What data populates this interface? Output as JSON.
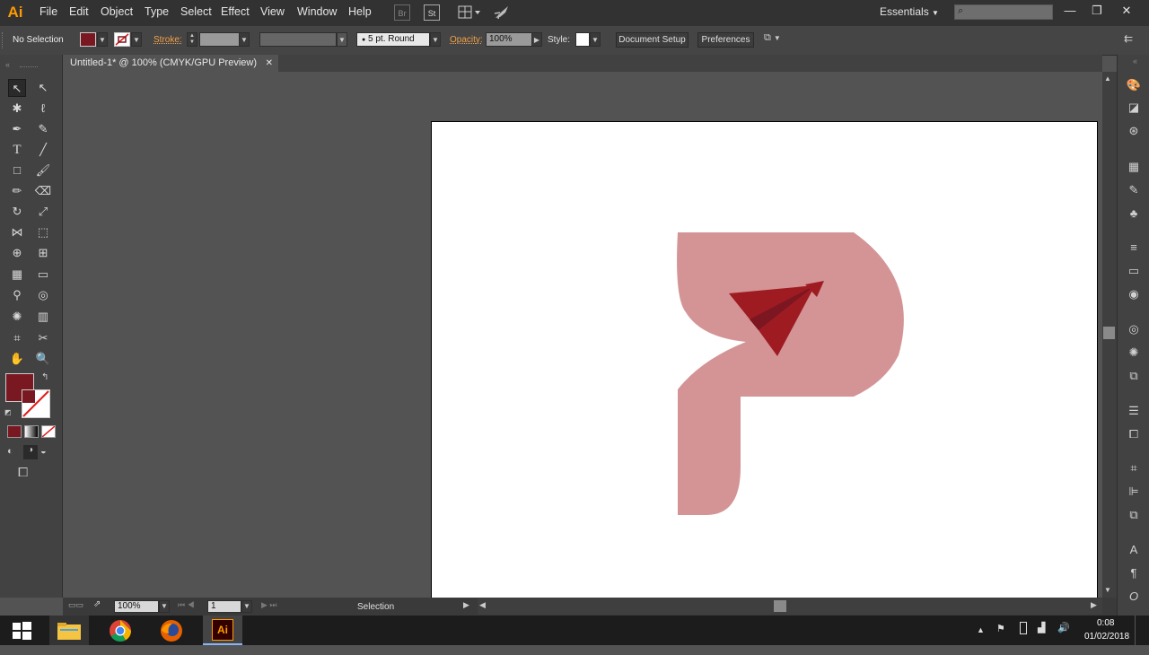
{
  "app": {
    "logo": "Ai",
    "tab_title": "Untitled-1* @ 100% (CMYK/GPU Preview)"
  },
  "menu": [
    "File",
    "Edit",
    "Object",
    "Type",
    "Select",
    "Effect",
    "View",
    "Window",
    "Help"
  ],
  "menubar_icons": {
    "bridge": "Br",
    "stock": "St"
  },
  "workspace": "Essentials",
  "control": {
    "selection": "No Selection",
    "stroke_label": "Stroke:",
    "brush": "5 pt. Round",
    "opacity_label": "Opacity:",
    "opacity_value": "100%",
    "style_label": "Style:",
    "doc_setup": "Document Setup",
    "preferences": "Preferences"
  },
  "colors": {
    "fill": "#7a1822",
    "logo_light": "#d49495",
    "logo_dark": "#9e1b22",
    "logo_shadow": "#7c1620",
    "accent": "#f0a24a"
  },
  "status": {
    "zoom": "100%",
    "artboard": "1",
    "tool": "Selection"
  },
  "taskbar": {
    "time": "0:08",
    "date": "01/02/2018",
    "apps": [
      "windows-start",
      "file-explorer",
      "chrome",
      "firefox",
      "illustrator"
    ],
    "ai_label": "Ai"
  }
}
